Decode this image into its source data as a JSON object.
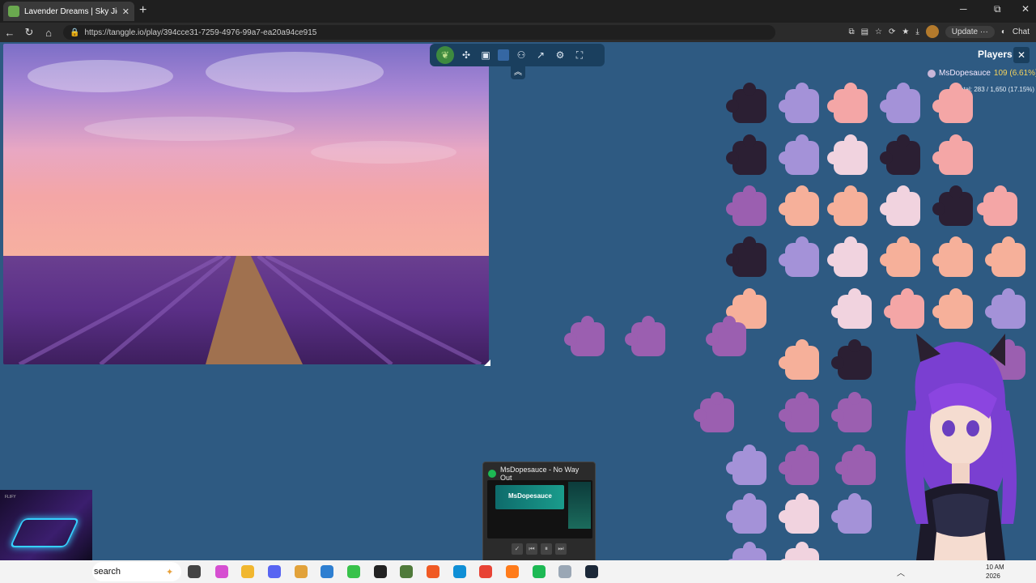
{
  "browser": {
    "tab_title": "Lavender Dreams | Sky Jigsaw",
    "tab_close": "✕",
    "new_tab": "+",
    "url": "https://tanggle.io/play/394cce31-7259-4976-99a7-ea20a94ce915",
    "update_label": "Update",
    "more_label": "···",
    "chat_label": "Chat"
  },
  "window_controls": {
    "minimize": "─",
    "maximize": "⧉",
    "close": "✕"
  },
  "players_panel": {
    "title": "Players",
    "close": "✕",
    "player_name": "MsDopesauce",
    "player_score": "109 (6.61%)",
    "total": "Total: 283 / 1,650 (17.15%)"
  },
  "toolbar": {
    "collapse": "︽"
  },
  "spotify": {
    "title": "MsDopesauce - No Way Out",
    "banner_text": "MsDopesauce"
  },
  "taskbar": {
    "search_text": "search",
    "time": "10 AM",
    "date": "2026"
  },
  "icons": {
    "back": "back-arrow-icon",
    "reload": "reload-icon",
    "home": "home-icon",
    "puzzle": "puzzle-piece-icon",
    "image": "image-icon",
    "players": "players-icon",
    "share": "share-icon",
    "settings": "gear-icon",
    "fullscreen": "fullscreen-icon"
  },
  "colors": {
    "game_bg": "#2e5a82",
    "toolbar_bg": "#1a3f5e",
    "player_score": "#f4d35e",
    "spotify_green": "#1db954"
  }
}
